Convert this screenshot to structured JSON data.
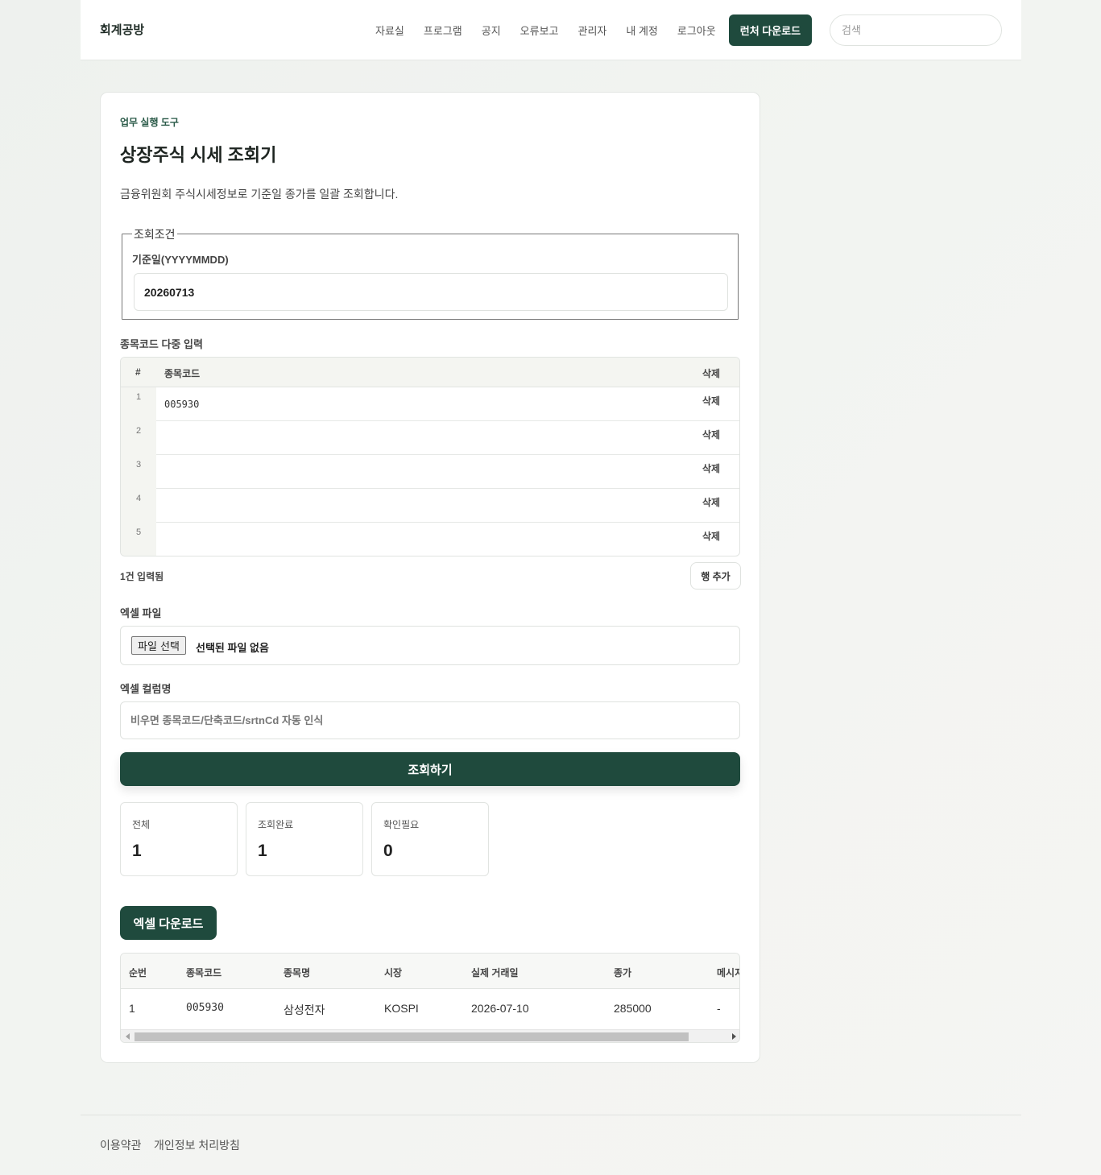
{
  "header": {
    "brand": "회계공방",
    "nav": [
      "자료실",
      "프로그램",
      "공지",
      "오류보고",
      "관리자",
      "내 계정",
      "로그아웃"
    ],
    "launcher_label": "런처 다운로드",
    "search_placeholder": "검색"
  },
  "tool": {
    "eyebrow": "업무 실행 도구",
    "title": "상장주식 시세 조회기",
    "description": "금융위원회 주식시세정보로 기준일 종가를 일괄 조회합니다."
  },
  "conditions": {
    "legend": "조회조건",
    "date_label": "기준일(YYYYMMDD)",
    "date_value": "20260713"
  },
  "codes": {
    "label": "종목코드 다중 입력",
    "headers": {
      "num": "#",
      "code": "종목코드",
      "delete": "삭제"
    },
    "rows": [
      {
        "num": "1",
        "code": "005930",
        "delete": "삭제"
      },
      {
        "num": "2",
        "code": "",
        "delete": "삭제"
      },
      {
        "num": "3",
        "code": "",
        "delete": "삭제"
      },
      {
        "num": "4",
        "code": "",
        "delete": "삭제"
      },
      {
        "num": "5",
        "code": "",
        "delete": "삭제"
      }
    ],
    "count_text": "1건 입력됨",
    "add_row_label": "행 추가"
  },
  "excel": {
    "file_label": "엑셀 파일",
    "file_button": "파일 선택",
    "file_none": "선택된 파일 없음",
    "column_label": "엑셀 컬럼명",
    "column_placeholder": "비우면 종목코드/단축코드/srtnCd 자동 인식"
  },
  "submit_label": "조회하기",
  "stats": [
    {
      "label": "전체",
      "value": "1"
    },
    {
      "label": "조회완료",
      "value": "1"
    },
    {
      "label": "확인필요",
      "value": "0"
    }
  ],
  "excel_download_label": "엑셀 다운로드",
  "results": {
    "headers": [
      "순번",
      "종목코드",
      "종목명",
      "시장",
      "실제 거래일",
      "종가",
      "메시지"
    ],
    "rows": [
      [
        "1",
        "005930",
        "삼성전자",
        "KOSPI",
        "2026-07-10",
        "285000",
        "-"
      ]
    ]
  },
  "footer": {
    "terms": "이용약관",
    "privacy": "개인정보 처리방침"
  },
  "colors": {
    "accent": "#1f4a3d",
    "eyebrow": "#2a5a48"
  }
}
